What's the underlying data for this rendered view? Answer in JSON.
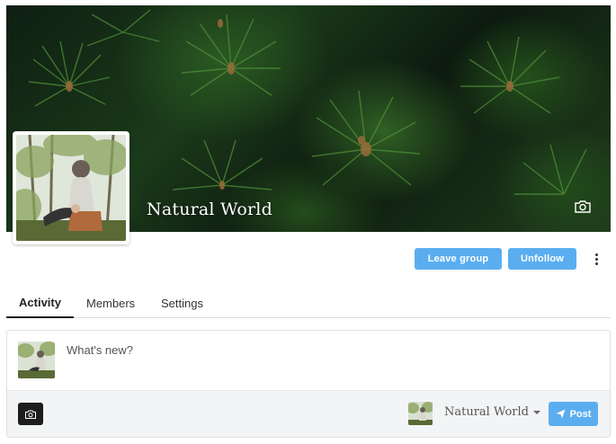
{
  "group": {
    "name": "Natural World",
    "cover_icon": "camera-icon",
    "accent_color": "#5aaef0"
  },
  "actions": {
    "leave_label": "Leave group",
    "unfollow_label": "Unfollow",
    "more_icon": "more-vertical-icon"
  },
  "tabs": [
    {
      "label": "Activity",
      "active": true
    },
    {
      "label": "Members",
      "active": false
    },
    {
      "label": "Settings",
      "active": false
    }
  ],
  "composer": {
    "placeholder": "What's new?",
    "photo_icon": "camera-icon",
    "post_in": "Natural World",
    "post_label": "Post",
    "post_icon": "send-icon"
  }
}
